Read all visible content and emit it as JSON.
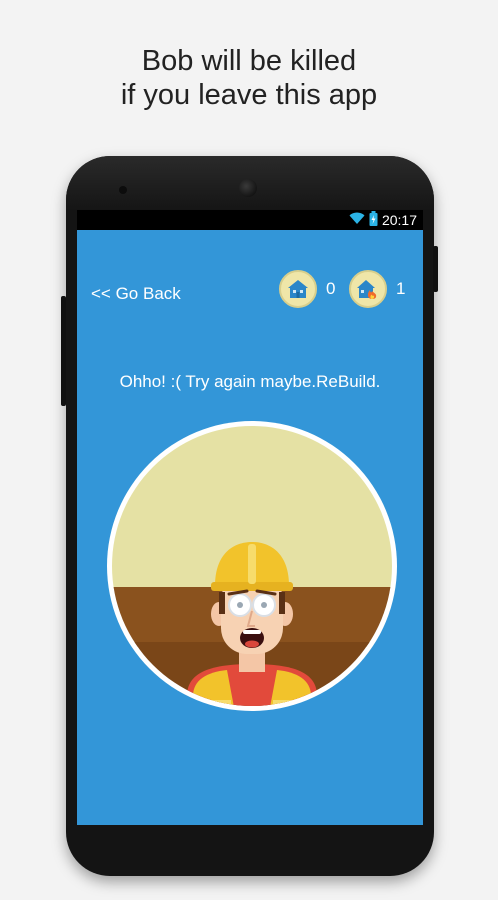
{
  "headline": {
    "line1": "Bob will be killed",
    "line2": "if you leave this app"
  },
  "status_bar": {
    "time": "20:17",
    "icons": [
      "wifi-icon",
      "battery-charging-icon"
    ]
  },
  "app": {
    "go_back_label": "<< Go Back",
    "built_count": "0",
    "burned_count": "1",
    "message": "Ohho! :( Try again maybe.ReBuild.",
    "background_color": "#3396d8"
  },
  "scene": {
    "description_icon": "crying-worker-illustration",
    "sky_color": "#e5e1a4",
    "ground_color": "#8a521e",
    "border_color": "#ffffff"
  }
}
